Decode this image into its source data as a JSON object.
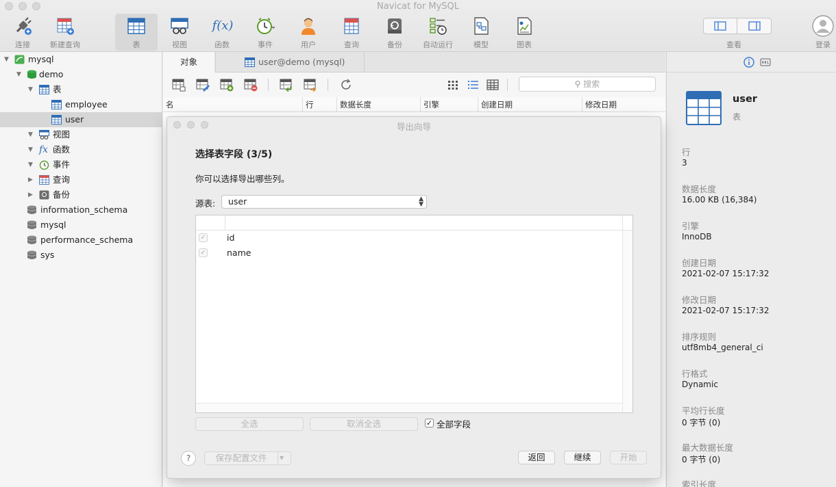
{
  "window": {
    "title": "Navicat for MySQL"
  },
  "toolbar": {
    "buttons": [
      {
        "label": "连接",
        "icon": "plug-icon"
      },
      {
        "label": "新建查询",
        "icon": "new-query-icon"
      },
      {
        "label": "表",
        "icon": "table-icon",
        "active": true
      },
      {
        "label": "视图",
        "icon": "view-icon"
      },
      {
        "label": "函数",
        "icon": "function-icon",
        "glyph": "f(x)"
      },
      {
        "label": "事件",
        "icon": "clock-icon"
      },
      {
        "label": "用户",
        "icon": "user-icon"
      },
      {
        "label": "查询",
        "icon": "query-icon"
      },
      {
        "label": "备份",
        "icon": "backup-icon"
      },
      {
        "label": "自动运行",
        "icon": "schedule-icon"
      },
      {
        "label": "模型",
        "icon": "model-icon"
      },
      {
        "label": "图表",
        "icon": "chart-icon"
      }
    ],
    "view_label": "查看",
    "login_label": "登录"
  },
  "sidebar": {
    "items": [
      {
        "label": "mysql",
        "icon": "connection-icon",
        "expanded": true
      },
      {
        "label": "demo",
        "icon": "database-icon",
        "expanded": true
      },
      {
        "label": "表",
        "icon": "tables-folder-icon",
        "expanded": true
      },
      {
        "label": "employee",
        "icon": "table-icon"
      },
      {
        "label": "user",
        "icon": "table-icon",
        "selected": true
      },
      {
        "label": "视图",
        "icon": "views-folder-icon",
        "expanded": true
      },
      {
        "label": "函数",
        "icon": "functions-folder-icon",
        "expanded": true,
        "glyph": "fx"
      },
      {
        "label": "事件",
        "icon": "events-folder-icon",
        "expanded": true
      },
      {
        "label": "查询",
        "icon": "queries-folder-icon",
        "expanded": false
      },
      {
        "label": "备份",
        "icon": "backups-folder-icon",
        "expanded": false
      },
      {
        "label": "information_schema",
        "icon": "database-icon"
      },
      {
        "label": "mysql",
        "icon": "database-icon"
      },
      {
        "label": "performance_schema",
        "icon": "database-icon"
      },
      {
        "label": "sys",
        "icon": "database-icon"
      }
    ]
  },
  "tabs": [
    {
      "label": "对象"
    },
    {
      "label": "user@demo (mysql)"
    }
  ],
  "object_list": {
    "search_placeholder": "搜索",
    "columns": [
      "名",
      "行",
      "数据长度",
      "引擎",
      "创建日期",
      "修改日期"
    ]
  },
  "info_panel": {
    "name": "user",
    "type": "表",
    "fields": [
      {
        "label": "行",
        "value": "3"
      },
      {
        "label": "数据长度",
        "value": "16.00 KB (16,384)"
      },
      {
        "label": "引擎",
        "value": "InnoDB"
      },
      {
        "label": "创建日期",
        "value": "2021-02-07 15:17:32"
      },
      {
        "label": "修改日期",
        "value": "2021-02-07 15:17:32"
      },
      {
        "label": "排序规则",
        "value": "utf8mb4_general_ci"
      },
      {
        "label": "行格式",
        "value": "Dynamic"
      },
      {
        "label": "平均行长度",
        "value": "0 字节 (0)"
      },
      {
        "label": "最大数据长度",
        "value": "0 字节 (0)"
      },
      {
        "label": "索引长度",
        "value": ""
      }
    ]
  },
  "dialog": {
    "title": "导出向导",
    "step_title": "选择表字段 (3/5)",
    "description": "你可以选择导出哪些列。",
    "source_label": "源表:",
    "source_value": "user",
    "fields": [
      {
        "name": "id",
        "checked": true
      },
      {
        "name": "name",
        "checked": true
      }
    ],
    "select_all_label": "全选",
    "deselect_all_label": "取消全选",
    "all_fields_label": "全部字段",
    "all_fields_checked": true,
    "help_label": "?",
    "save_profile_label": "保存配置文件",
    "back_label": "返回",
    "continue_label": "继续",
    "start_label": "开始"
  }
}
